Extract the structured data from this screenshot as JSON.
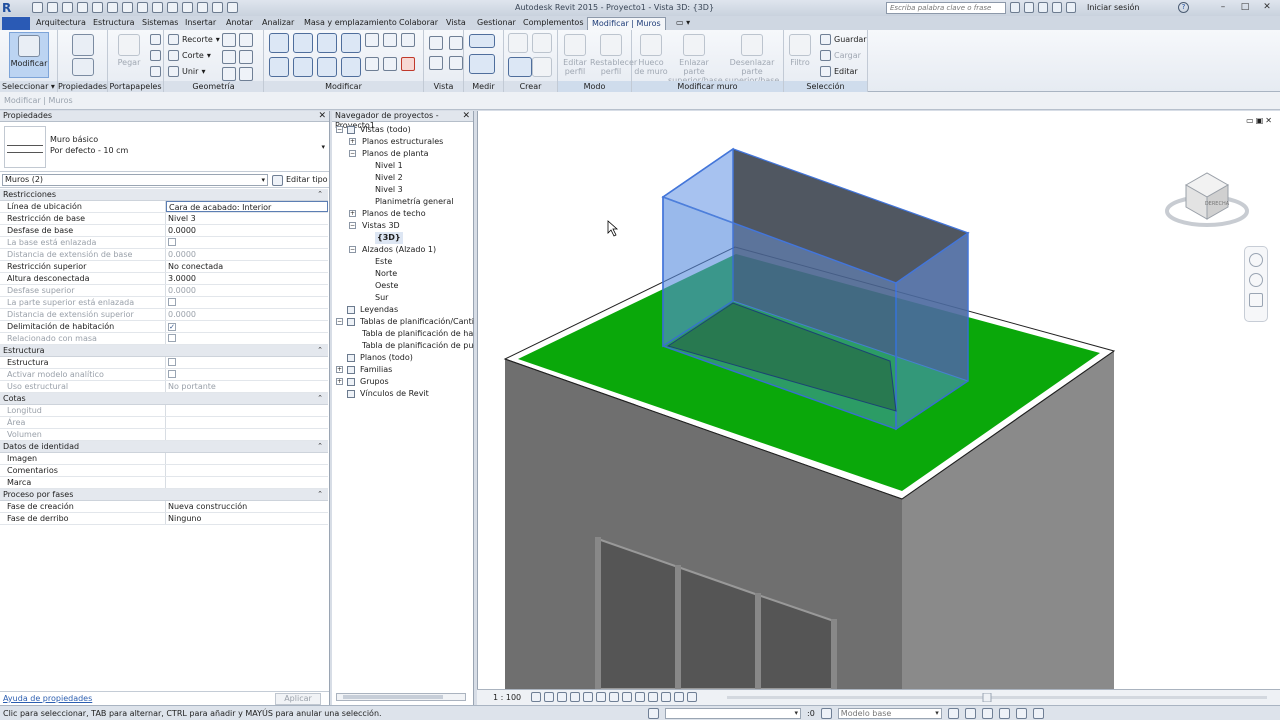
{
  "titlebar": {
    "logo": "R",
    "title": "Autodesk Revit 2015 -    Proyecto1 - Vista 3D: {3D}",
    "search_placeholder": "Escriba palabra clave o frase",
    "signin": "Iniciar sesión",
    "help": "?",
    "minimize": "–",
    "maximize": "□",
    "close": "✕"
  },
  "tabs": [
    "Arquitectura",
    "Estructura",
    "Sistemas",
    "Insertar",
    "Anotar",
    "Analizar",
    "Masa y emplazamiento",
    "Colaborar",
    "Vista",
    "Gestionar",
    "Complementos",
    "Modificar | Muros"
  ],
  "ribbon": {
    "modify_label": "Modificar",
    "select_panel": "Seleccionar ▾",
    "props_panel": "Propiedades",
    "clipboard_panel": "Portapapeles",
    "paste_label": "Pegar",
    "geometry_panel": "Geometría",
    "cope_label": "Recorte",
    "cut_label": "Corte",
    "join_label": "Unir",
    "modify_panel": "Modificar",
    "view_panel": "Vista",
    "measure_panel": "Medir",
    "create_panel": "Crear",
    "mode_panel": "Modo",
    "edit_profile": "Editar perfil",
    "reset_profile": "Restablecer perfil",
    "modify_wall_panel": "Modificar muro",
    "wall_opening": "Hueco de muro",
    "attach": "Enlazar parte superior/base",
    "detach": "Desenlazar parte superior/base",
    "selection_panel": "Selección",
    "filter": "Filtro",
    "save": "Guardar",
    "load": "Cargar",
    "edit": "Editar"
  },
  "contextbar": "Modificar | Muros",
  "properties": {
    "title": "Propiedades",
    "type_name": "Muro básico",
    "type_sub": "Por defecto - 10 cm",
    "instance": "Muros (2)",
    "edit_type": "Editar tipo",
    "help": "Ayuda de propiedades",
    "apply": "Aplicar",
    "groups": [
      {
        "name": "Restricciones",
        "rows": [
          {
            "label": "Línea de ubicación",
            "value": "Cara de acabado: Interior",
            "dis": false,
            "sel": true
          },
          {
            "label": "Restricción de base",
            "value": "Nivel 3",
            "dis": false
          },
          {
            "label": "Desfase de base",
            "value": "0.0000",
            "dis": false
          },
          {
            "label": "La base está enlazada",
            "value": "",
            "check": "empty",
            "dis": true
          },
          {
            "label": "Distancia de extensión de base",
            "value": "0.0000",
            "dis": true
          },
          {
            "label": "Restricción superior",
            "value": "No conectada",
            "dis": false
          },
          {
            "label": "Altura desconectada",
            "value": "3.0000",
            "dis": false
          },
          {
            "label": "Desfase superior",
            "value": "0.0000",
            "dis": true
          },
          {
            "label": "La parte superior está enlazada",
            "value": "",
            "check": "empty",
            "dis": true
          },
          {
            "label": "Distancia de extensión superior",
            "value": "0.0000",
            "dis": true
          },
          {
            "label": "Delimitación de habitación",
            "value": "",
            "check": "checked",
            "dis": false
          },
          {
            "label": "Relacionado con masa",
            "value": "",
            "check": "empty",
            "dis": true
          }
        ]
      },
      {
        "name": "Estructura",
        "rows": [
          {
            "label": "Estructura",
            "value": "",
            "check": "empty",
            "dis": false
          },
          {
            "label": "Activar modelo analítico",
            "value": "",
            "check": "empty",
            "dis": true
          },
          {
            "label": "Uso estructural",
            "value": "No portante",
            "dis": true
          }
        ]
      },
      {
        "name": "Cotas",
        "rows": [
          {
            "label": "Longitud",
            "value": "",
            "dis": true
          },
          {
            "label": "Área",
            "value": "",
            "dis": true
          },
          {
            "label": "Volumen",
            "value": "",
            "dis": true
          }
        ]
      },
      {
        "name": "Datos de identidad",
        "rows": [
          {
            "label": "Imagen",
            "value": "",
            "dis": false
          },
          {
            "label": "Comentarios",
            "value": "",
            "dis": false
          },
          {
            "label": "Marca",
            "value": "",
            "dis": false
          }
        ]
      },
      {
        "name": "Proceso por fases",
        "rows": [
          {
            "label": "Fase de creación",
            "value": "Nueva construcción",
            "dis": false
          },
          {
            "label": "Fase de derribo",
            "value": "Ninguno",
            "dis": false
          }
        ]
      }
    ]
  },
  "browser": {
    "title": "Navegador de proyectos - Proyecto1",
    "nodes": [
      {
        "label": "Vistas (todo)",
        "level": 0,
        "exp": "−",
        "icon": true
      },
      {
        "label": "Planos estructurales",
        "level": 1,
        "exp": "+"
      },
      {
        "label": "Planos de planta",
        "level": 1,
        "exp": "−"
      },
      {
        "label": "Nivel 1",
        "level": 2
      },
      {
        "label": "Nivel 2",
        "level": 2
      },
      {
        "label": "Nivel 3",
        "level": 2
      },
      {
        "label": "Planimetría general",
        "level": 2
      },
      {
        "label": "Planos de techo",
        "level": 1,
        "exp": "+"
      },
      {
        "label": "Vistas 3D",
        "level": 1,
        "exp": "−"
      },
      {
        "label": "{3D}",
        "level": 2,
        "selected": true
      },
      {
        "label": "Alzados (Alzado 1)",
        "level": 1,
        "exp": "−"
      },
      {
        "label": "Este",
        "level": 2
      },
      {
        "label": "Norte",
        "level": 2
      },
      {
        "label": "Oeste",
        "level": 2
      },
      {
        "label": "Sur",
        "level": 2
      },
      {
        "label": "Leyendas",
        "level": 0,
        "icon": true
      },
      {
        "label": "Tablas de planificación/Cantidades",
        "level": 0,
        "exp": "−",
        "icon": true
      },
      {
        "label": "Tabla de planificación de habitaciones",
        "level": 1
      },
      {
        "label": "Tabla de planificación de puertas",
        "level": 1
      },
      {
        "label": "Planos (todo)",
        "level": 0,
        "icon": true
      },
      {
        "label": "Familias",
        "level": 0,
        "exp": "+",
        "icon": true
      },
      {
        "label": "Grupos",
        "level": 0,
        "exp": "+",
        "icon": true
      },
      {
        "label": "Vínculos de Revit",
        "level": 0,
        "icon": true
      }
    ]
  },
  "viewcube": {
    "face": "DERECHA"
  },
  "viewbar": {
    "scale": "1 : 100"
  },
  "status": {
    "text": "Clic para seleccionar, TAB para alternar, CTRL para añadir y MAYÚS para anular una selección.",
    "zero": ":0",
    "model": "Modelo base"
  },
  "colors": {
    "roof_green": "#0aa80a",
    "wall_gray": "#6f6f6f",
    "glass_blue": "#5a8be0"
  }
}
